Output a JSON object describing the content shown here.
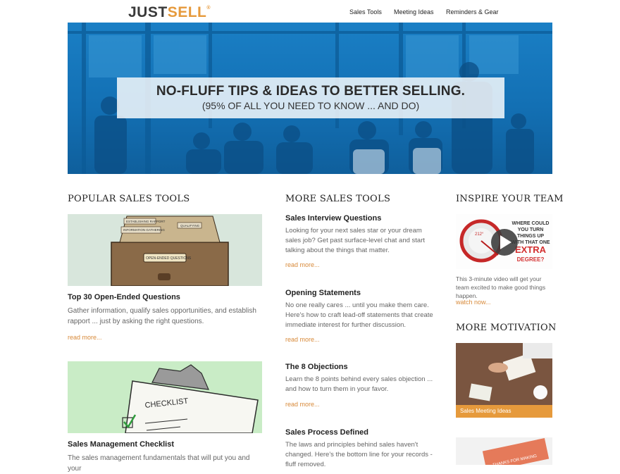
{
  "header": {
    "logo_just": "JUST",
    "logo_sell": "SELL",
    "logo_reg": "®",
    "nav": [
      "Sales Tools",
      "Meeting Ideas",
      "Reminders & Gear"
    ]
  },
  "hero": {
    "title": "NO-FLUFF TIPS & IDEAS TO BETTER SELLING.",
    "subtitle": "(95% OF ALL YOU NEED TO KNOW ... AND DO)"
  },
  "popular": {
    "heading": "POPULAR SALES TOOLS",
    "items": [
      {
        "title": "Top 30 Open-Ended Questions",
        "desc": "Gather information, qualify sales opportunities, and establish rapport ... just by asking the right questions.",
        "more": "read more...",
        "image_labels": [
          "ESTABLISHING RAPPORT",
          "INFORMATION GATHERING",
          "QUALIFYING",
          "OPEN-ENDED QUESTIONS"
        ]
      },
      {
        "title": "Sales Management Checklist",
        "desc": "The sales management fundamentals that will put you and your",
        "image_label": "CHECKLIST"
      }
    ]
  },
  "more_tools": {
    "heading": "MORE SALES TOOLS",
    "items": [
      {
        "title": "Sales Interview Questions",
        "desc": "Looking for your next sales star or your dream sales job? Get past surface-level chat and start talking about the things that matter.",
        "more": "read more..."
      },
      {
        "title": "Opening Statements",
        "desc": "No one really cares ... until you make them care. Here's how to craft lead-off statements that create immediate interest for further discussion.",
        "more": "read more..."
      },
      {
        "title": "The 8 Objections",
        "desc": "Learn the 8 points behind every sales objection ... and how to turn them in your favor.",
        "more": "read more..."
      },
      {
        "title": "Sales Process Defined",
        "desc": "The laws and principles behind sales haven't changed. Here's the bottom line for your records - fluff removed."
      }
    ]
  },
  "inspire": {
    "heading": "INSPIRE YOUR TEAM",
    "video_text": [
      "WHERE COULD",
      "YOU TURN",
      "THINGS UP",
      "WITH THAT ONE",
      "EXTRA",
      "DEGREE?"
    ],
    "gauge_label": "212°",
    "desc": "This 3-minute video will get your team excited to make good things happen.",
    "link": "watch now..."
  },
  "motivation": {
    "heading": "MORE MOTIVATION",
    "caption": "Sales Meeting Ideas",
    "card2_text": "THANKS FOR MAKING"
  },
  "colors": {
    "accent": "#e69a3c",
    "hero_blue": "#1a7fc5",
    "link": "#d88a3a"
  }
}
